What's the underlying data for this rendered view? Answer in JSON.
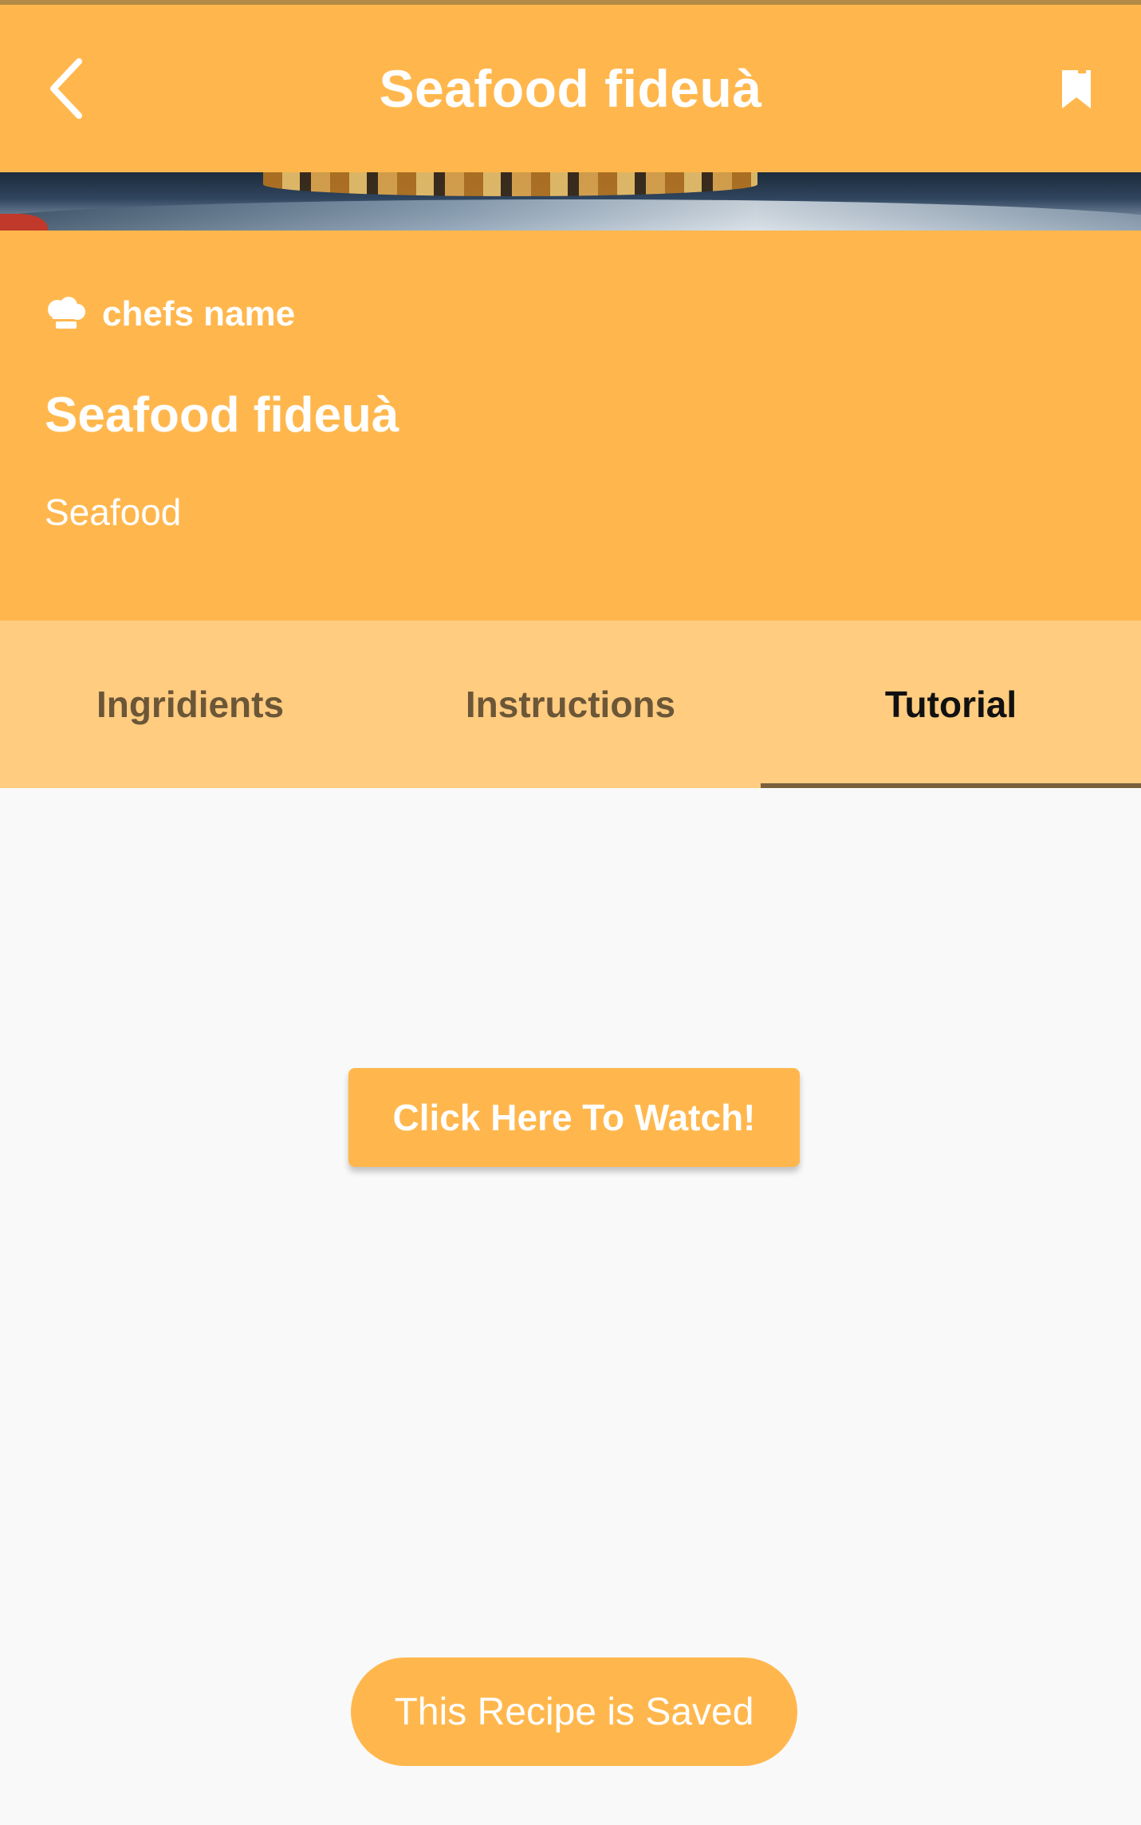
{
  "app_bar": {
    "title": "Seafood fideuà",
    "back_icon": "chevron-left-icon",
    "bookmark_icon": "bookmark-icon"
  },
  "recipe": {
    "chef_icon": "chef-hat-icon",
    "chef_name": "chefs name",
    "title": "Seafood fideuà",
    "category": "Seafood"
  },
  "tabs": [
    {
      "label": "Ingridients",
      "active": false
    },
    {
      "label": "Instructions",
      "active": false
    },
    {
      "label": "Tutorial",
      "active": true
    }
  ],
  "tutorial": {
    "watch_button_label": "Click Here To Watch!"
  },
  "toast": {
    "message": "This Recipe is Saved"
  },
  "colors": {
    "primary": "#ffb74d",
    "tab_bar": "#ffcc80",
    "background": "#f9f9f9",
    "indicator": "#7a5f3d"
  }
}
